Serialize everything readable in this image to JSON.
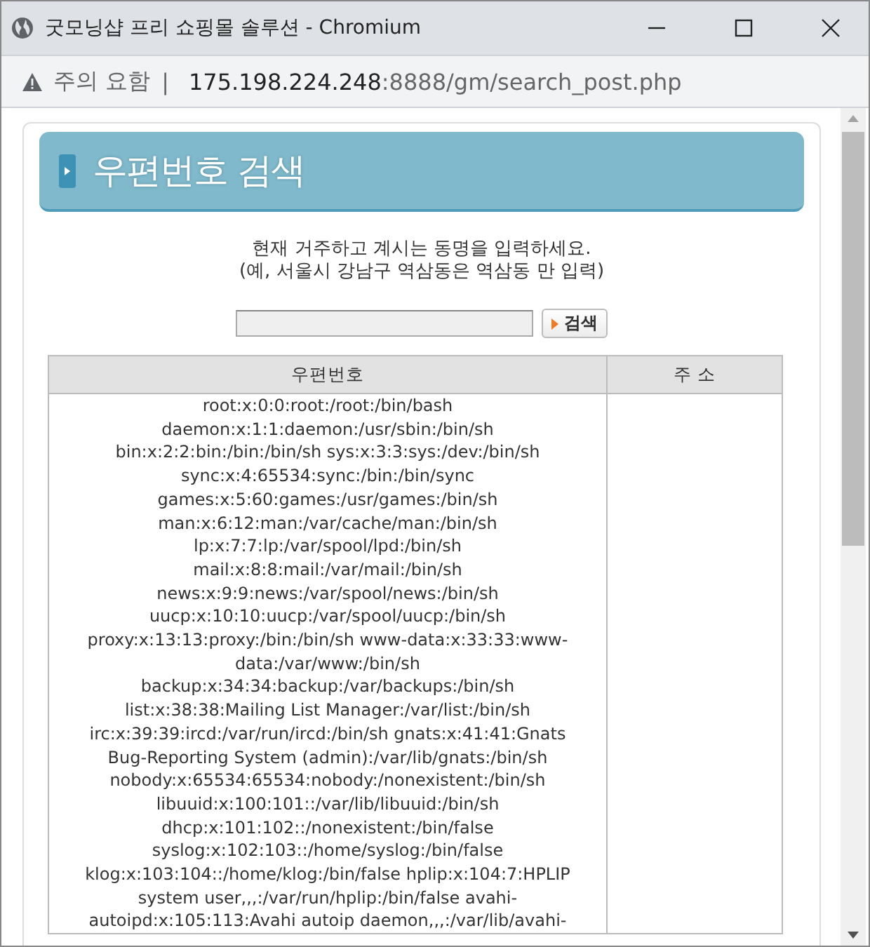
{
  "window": {
    "title": "굿모닝샵 프리 쇼핑몰 솔루션 - Chromium"
  },
  "address_bar": {
    "security_label": "주의 요함",
    "separator": "|",
    "url_host": "175.198.224.248",
    "url_rest": ":8888/gm/search_post.php"
  },
  "page": {
    "heading": "우편번호 검색",
    "instructions": [
      "현재 거주하고 계시는 동명을 입력하세요.",
      "(예, 서울시 강남구 역삼동은 역삼동 만 입력)"
    ],
    "search_button": "검색",
    "table": {
      "columns": [
        "우편번호",
        "주 소"
      ],
      "rows": [
        {
          "zipcode_lines": [
            "root:x:0:0:root:/root:/bin/bash",
            "daemon:x:1:1:daemon:/usr/sbin:/bin/sh",
            "bin:x:2:2:bin:/bin:/bin/sh sys:x:3:3:sys:/dev:/bin/sh",
            "sync:x:4:65534:sync:/bin:/bin/sync",
            "games:x:5:60:games:/usr/games:/bin/sh",
            "man:x:6:12:man:/var/cache/man:/bin/sh",
            "lp:x:7:7:lp:/var/spool/lpd:/bin/sh",
            "mail:x:8:8:mail:/var/mail:/bin/sh",
            "news:x:9:9:news:/var/spool/news:/bin/sh",
            "uucp:x:10:10:uucp:/var/spool/uucp:/bin/sh",
            "proxy:x:13:13:proxy:/bin:/bin/sh www-data:x:33:33:www-",
            "data:/var/www:/bin/sh",
            "backup:x:34:34:backup:/var/backups:/bin/sh",
            "list:x:38:38:Mailing List Manager:/var/list:/bin/sh",
            "irc:x:39:39:ircd:/var/run/ircd:/bin/sh gnats:x:41:41:Gnats",
            "Bug-Reporting System (admin):/var/lib/gnats:/bin/sh",
            "nobody:x:65534:65534:nobody:/nonexistent:/bin/sh",
            "libuuid:x:100:101::/var/lib/libuuid:/bin/sh",
            "dhcp:x:101:102::/nonexistent:/bin/false",
            "syslog:x:102:103::/home/syslog:/bin/false",
            "klog:x:103:104::/home/klog:/bin/false hplip:x:104:7:HPLIP",
            "system user,,,:/var/run/hplip:/bin/false avahi-",
            "autoipd:x:105:113:Avahi autoip daemon,,,:/var/lib/avahi-"
          ]
        }
      ]
    }
  }
}
